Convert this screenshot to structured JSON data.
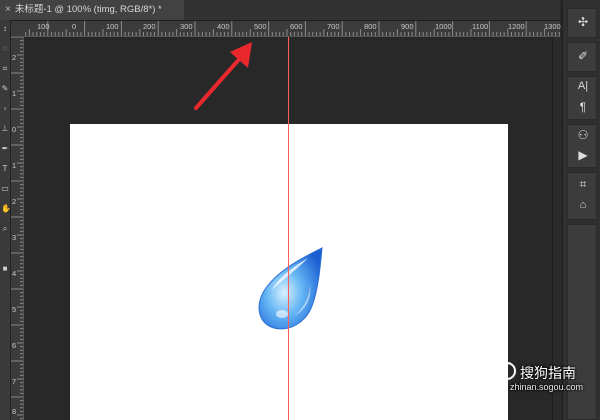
{
  "document_tab": {
    "close_glyph": "×",
    "title": "未标题-1 @ 100% (timg, RGB/8*) *"
  },
  "ruler": {
    "h_labels": [
      "100",
      "0",
      "100",
      "200",
      "300",
      "400",
      "500",
      "600",
      "700",
      "800",
      "900",
      "1000",
      "1100",
      "1200",
      "1300"
    ],
    "v_labels": [
      "2",
      "1",
      "0",
      "1",
      "2",
      "3",
      "4",
      "5",
      "6",
      "7",
      "8"
    ]
  },
  "annotation": {
    "arrow_color": "#e8282d"
  },
  "guide": {
    "color": "#ff5b5b"
  },
  "colors": {
    "droplet": "#3f8fe8",
    "canvas_bg": "#282828",
    "panel_bg": "#303030"
  },
  "right_panel": {
    "icons": [
      "puzzle-icon",
      "brush-settings-icon",
      "character-icon",
      "paragraph-icon",
      "stamp-icon",
      "play-icon",
      "crop-icon",
      "timeline-icon"
    ]
  },
  "watermark": {
    "brand": "搜狗指南",
    "url": "zhinan.sogou.com"
  }
}
